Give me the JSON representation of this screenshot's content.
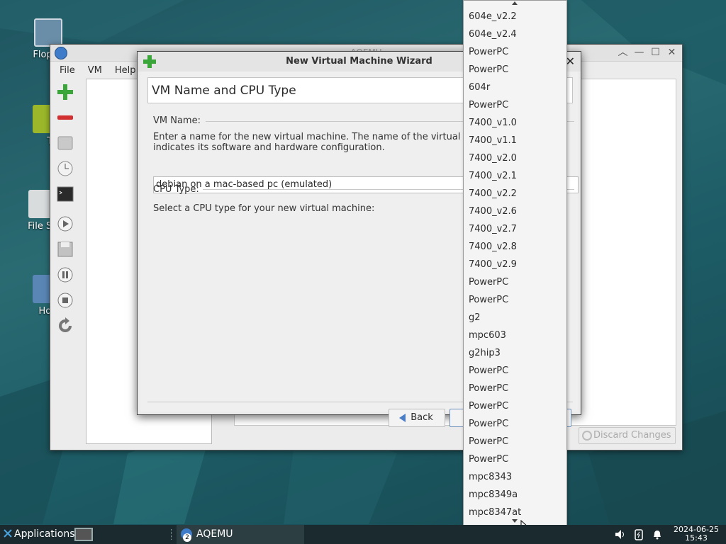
{
  "desktop": {
    "icons": [
      {
        "label": "Floppy",
        "name": "floppy"
      },
      {
        "label": "Tra",
        "name": "trash"
      },
      {
        "label": "File Sy",
        "name": "filesystem"
      },
      {
        "label": "Hor",
        "name": "home"
      }
    ]
  },
  "main_window": {
    "title": "AQEMU",
    "menu": [
      {
        "label": "File"
      },
      {
        "label": "VM"
      },
      {
        "label": "Help"
      }
    ],
    "toolbar_icons": [
      "add-vm-icon",
      "remove-vm-icon",
      "hdd-icon",
      "clock-icon",
      "terminal-icon",
      "start-icon",
      "save-icon",
      "pause-icon",
      "stop-icon",
      "reset-icon"
    ],
    "discard_button": "Discard Changes"
  },
  "wizard": {
    "title": "New Virtual Machine Wizard",
    "page_heading": "VM Name and CPU Type",
    "vm_name_label": "VM Name:",
    "vm_name_desc_line1": "Enter a name for the new virtual machine. The name of the virtual",
    "vm_name_desc_line2": "indicates its software and hardware configuration.",
    "vm_name_value": "debian on a mac-based pc (emulated)",
    "cpu_type_label": "CPU Type:",
    "cpu_type_desc": "Select a CPU type for your new virtual machine:",
    "back_button": "Back"
  },
  "cpu_dropdown": {
    "items": [
      "604e_v2.2",
      "604e_v2.4",
      "PowerPC",
      "PowerPC",
      "604r",
      "PowerPC",
      "7400_v1.0",
      "7400_v1.1",
      "7400_v2.0",
      "7400_v2.1",
      "7400_v2.2",
      "7400_v2.6",
      "7400_v2.7",
      "7400_v2.8",
      "7400_v2.9",
      "PowerPC",
      "PowerPC",
      "g2",
      "mpc603",
      "g2hip3",
      "PowerPC",
      "PowerPC",
      "PowerPC",
      "PowerPC",
      "PowerPC",
      "PowerPC",
      "mpc8343",
      "mpc8349a",
      "mpc8347at"
    ]
  },
  "taskbar": {
    "applications_label": "Applications",
    "task_label": "AQEMU",
    "task_badge": "2",
    "clock_date": "2024-06-25",
    "clock_time": "15:43"
  },
  "colors": {
    "desktop_bg": "#1f5560",
    "taskbar_bg": "#1a2a2e",
    "accent_green": "#3aa63a",
    "accent_red": "#d23030"
  }
}
